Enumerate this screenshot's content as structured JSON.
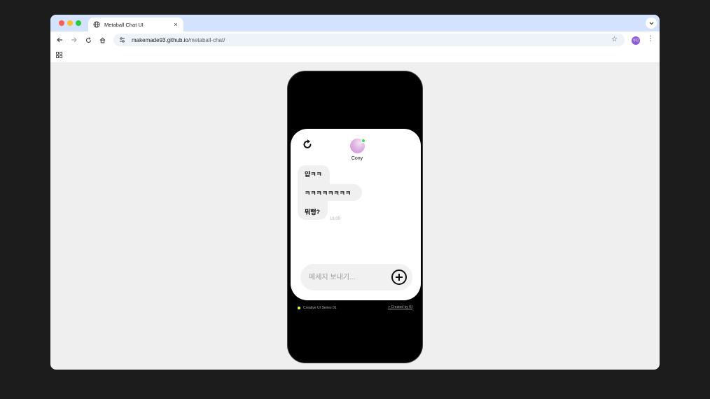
{
  "browser": {
    "tab_title": "Metaball Chat UI",
    "tab_close": "×",
    "url_host": "makemade93.github.io",
    "url_path": "/metaball-chat/",
    "profile_initials": "유진",
    "traffic_colors": [
      "#ff5f57",
      "#febc2e",
      "#28c840"
    ]
  },
  "chat": {
    "contact_name": "Cony",
    "messages": [
      {
        "text": "얍ㅋㅋ"
      },
      {
        "text": "ㅋㅋㅋㅋㅋㅋㅋㅋ"
      },
      {
        "text": "뭐행?"
      }
    ],
    "timestamp": "16:00",
    "composer_placeholder": "메세지 보내기..."
  },
  "footer": {
    "series": "Creative UI Series 01",
    "credit": "> Created by KI",
    "accent": "#e9ff3b"
  },
  "icons": {
    "refresh": "refresh-icon",
    "add": "plus-circle-icon",
    "star": "star-icon",
    "apps": "apps-grid-icon"
  }
}
